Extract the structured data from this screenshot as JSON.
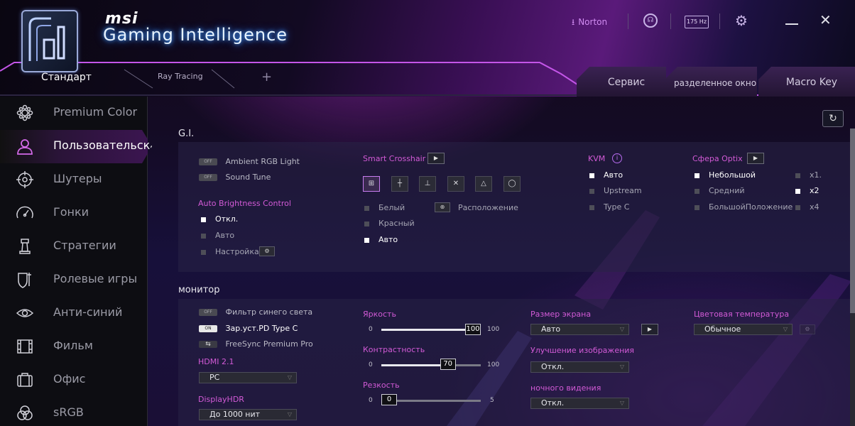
{
  "header": {
    "brand": "msi",
    "title": "Gaming Intelligence",
    "norton_label": "Norton",
    "hz_label": "175 Hz",
    "tabs": {
      "standard": "Стандарт",
      "raytracing": "Ray Tracing",
      "add": "+"
    },
    "right_tabs": {
      "service": "Сервис",
      "split": "разделенное окно",
      "macro": "Macro Key"
    }
  },
  "sidebar": {
    "items": [
      {
        "label": "Premium Color",
        "icon": "palette-icon"
      },
      {
        "label": "Пользовательска",
        "icon": "user-icon"
      },
      {
        "label": "Шутеры",
        "icon": "crosshair-icon"
      },
      {
        "label": "Гонки",
        "icon": "speedometer-icon"
      },
      {
        "label": "Стратегии",
        "icon": "chess-icon"
      },
      {
        "label": "Ролевые игры",
        "icon": "shield-icon"
      },
      {
        "label": "Анти-синий",
        "icon": "eye-icon"
      },
      {
        "label": "Фильм",
        "icon": "film-icon"
      },
      {
        "label": "Офис",
        "icon": "briefcase-icon"
      },
      {
        "label": "sRGB",
        "icon": "rgb-circles-icon"
      }
    ],
    "active_index": 1
  },
  "gi": {
    "title": "G.I.",
    "ambient": {
      "toggle": "OFF",
      "label": "Ambient RGB Light"
    },
    "sound": {
      "toggle": "OFF",
      "label": "Sound Tune"
    },
    "abc": {
      "title": "Auto Brightness Control",
      "options": [
        "Откл.",
        "Авто",
        "Настройка"
      ],
      "selected": 0
    },
    "crosshair": {
      "title": "Smart Crosshair",
      "colors": [
        "Белый",
        "Красный",
        "Авто"
      ],
      "selected": 2,
      "position_label": "Расположение"
    },
    "kvm": {
      "title": "KVM",
      "options": [
        "Авто",
        "Upstream",
        "Type C"
      ],
      "selected": 0
    },
    "optix": {
      "title": "Сфера Optix",
      "options": [
        "Небольшой",
        "Средний",
        "БольшойПоложение"
      ],
      "selected": 0,
      "zoom": [
        "x1.",
        "x2",
        "x4"
      ],
      "zoom_selected": 1
    }
  },
  "monitor": {
    "title": "монитор",
    "bluelight": {
      "toggle": "OFF",
      "label": "Фильтр синего света"
    },
    "pd": {
      "toggle": "ON",
      "label": "Зар.уст.PD Type C"
    },
    "freesync": {
      "label": "FreeSync Premium Pro"
    },
    "hdmi": {
      "title": "HDMI 2.1",
      "value": "PC"
    },
    "hdr": {
      "title": "DisplayHDR",
      "value": "До 1000 нит"
    },
    "brightness": {
      "title": "Яркость",
      "min": "0",
      "max": "100",
      "value": "100",
      "fraction": 1.0
    },
    "contrast": {
      "title": "Контрастность",
      "min": "0",
      "max": "100",
      "value": "70",
      "fraction": 0.7
    },
    "sharpness": {
      "title": "Резкость",
      "min": "0",
      "max": "5",
      "value": "0",
      "fraction": 0.0
    },
    "screen_size": {
      "title": "Размер экрана",
      "value": "Авто"
    },
    "image_enh": {
      "title": "Улучшение изображения",
      "value": "Откл."
    },
    "night": {
      "title": "ночного видения",
      "value": "Откл."
    },
    "color_temp": {
      "title": "Цветовая температура",
      "value": "Обычное"
    }
  },
  "colors": {
    "accent": "#d25ad6",
    "active_sidebar": "#3b1550"
  }
}
